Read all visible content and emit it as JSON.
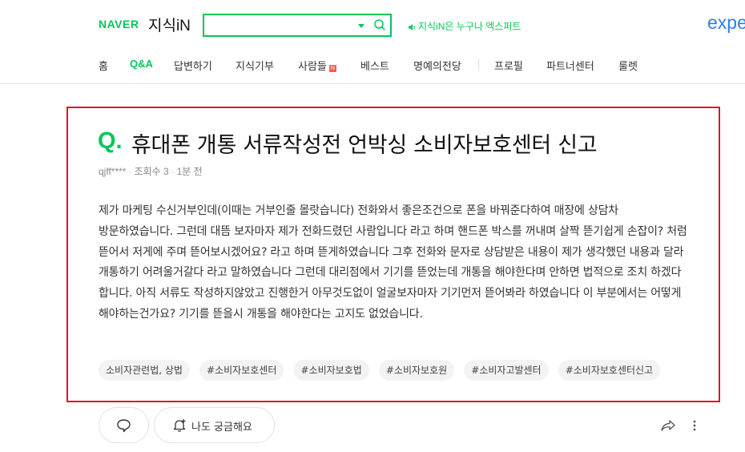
{
  "header": {
    "logo_naver": "NAVER",
    "logo_service": "지식iN",
    "search_placeholder": "",
    "notice": "지식iN은 누구나 엑스퍼트",
    "brand_right": "expe"
  },
  "nav": {
    "items": [
      {
        "label": "홈"
      },
      {
        "label": "Q&A",
        "active": true
      },
      {
        "label": "답변하기"
      },
      {
        "label": "지식기부"
      },
      {
        "label": "사람들",
        "badge": "N"
      },
      {
        "label": "베스트"
      },
      {
        "label": "명예의전당"
      },
      {
        "label": "프로필"
      },
      {
        "label": "파트너센터"
      },
      {
        "label": "룰렛"
      }
    ]
  },
  "question": {
    "mark": "Q.",
    "title": "휴대폰 개통 서류작성전 언박싱 소비자보호센터 신고",
    "author": "qjff****",
    "views": "조회수 3",
    "time": "1분 전",
    "body": "제가 마케팅 수신거부인데(이때는 거부인줄 몰랏습니다) 전화와서 좋은조건으로 폰을 바꿔준다하여 매장에 상담차 방문하였습니다. 그런데 대뜸 보자마자 제가 전화드렸던 사람입니다 라고 하며 핸드폰 박스를 꺼내며 살짝 뜯기쉽게 손잡이? 처럼 뜯어서 저게에 주며 뜯어보시겠어요? 라고 하며 뜯게하였습니다 그후 전화와 문자로 상담받은 내용이 제가 생각했던 내용과 달라 개통하기 어려울거갈다 라고 말하였습니다 그런데 대리점에서 기기를 뜯었는데 개통을 해야한다며 안하면 법적으로 조치 하겠다 합니다. 아직 서류도 작성하지않았고 진행한거 아무것도없이 얼굴보자마자 기기먼저 뜯어봐라 하였습니다 이 부분에서는 어떻게 해야하는건가요? 기기를 뜯을시 개통을 해야한다는 고지도 없었습니다.",
    "tags": [
      "소비자관련법, 상법",
      "#소비자보호센터",
      "#소비자보호법",
      "#소비자보호원",
      "#소비자고발센터",
      "#소비자보호센터신고"
    ]
  },
  "actions": {
    "curious_label": "나도 궁금해요"
  },
  "colors": {
    "brand_green": "#03c75a",
    "highlight_border": "#e0161c",
    "expert_blue": "#2e7fe6"
  }
}
